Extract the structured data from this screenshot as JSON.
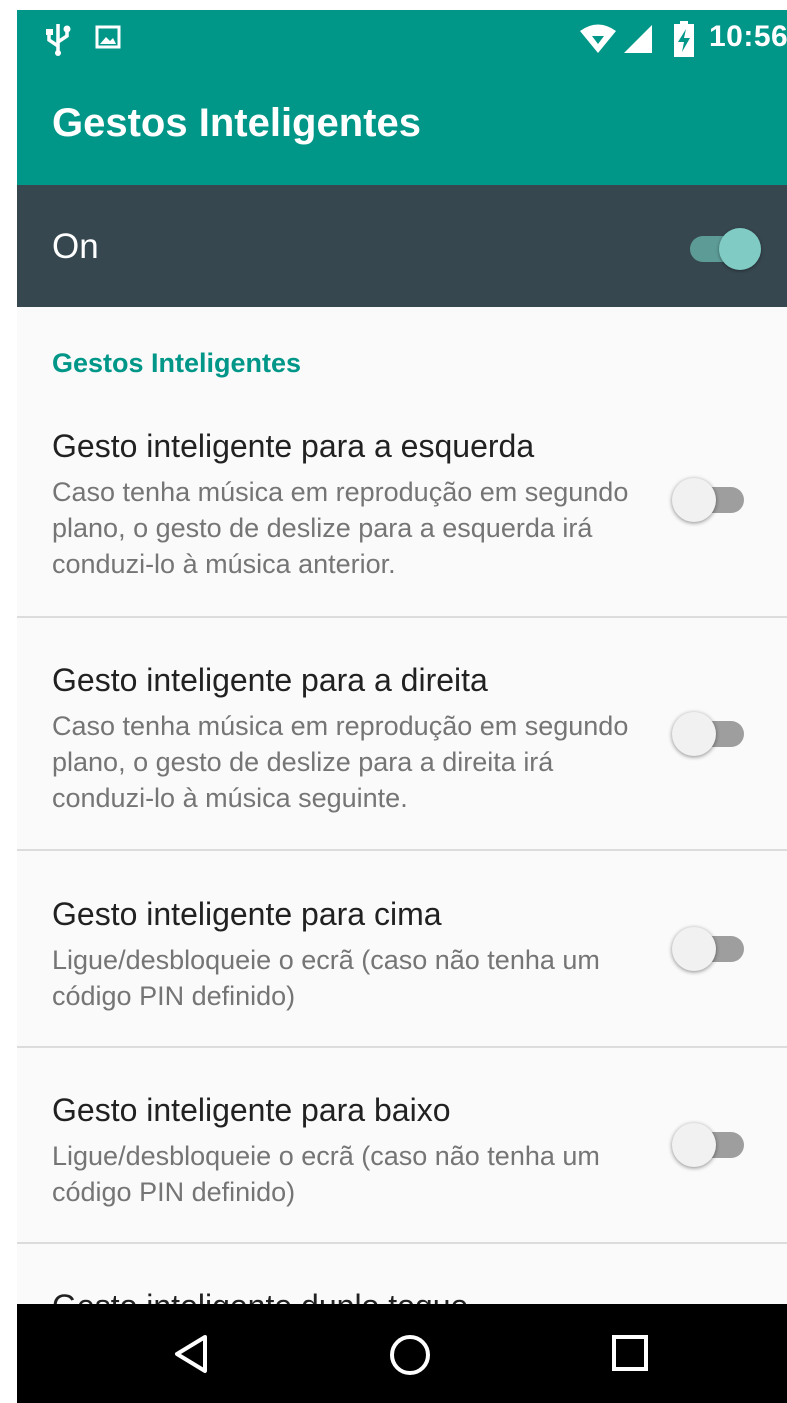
{
  "status_bar": {
    "time": "10:56",
    "icons": [
      "usb-icon",
      "gallery-icon",
      "wifi-icon",
      "cell-signal-icon",
      "battery-charging-icon"
    ]
  },
  "app_bar": {
    "title": "Gestos Inteligentes"
  },
  "master_switch": {
    "label": "On",
    "checked": true
  },
  "category": {
    "title": "Gestos Inteligentes"
  },
  "items": [
    {
      "title": "Gesto inteligente para a esquerda",
      "summary": "Caso tenha música em reprodução em segundo plano, o gesto de deslize para a esquerda irá conduzi-lo à música anterior.",
      "checked": false
    },
    {
      "title": "Gesto inteligente para a direita",
      "summary": "Caso tenha música em reprodução em segundo plano, o gesto de deslize para a direita irá conduzi-lo à música seguinte.",
      "checked": false
    },
    {
      "title": "Gesto inteligente para cima",
      "summary": "Ligue/desbloqueie o ecrã (caso não tenha um código PIN definido)",
      "checked": false
    },
    {
      "title": "Gesto inteligente para baixo",
      "summary": "Ligue/desbloqueie o ecrã (caso não tenha um código PIN definido)",
      "checked": false
    },
    {
      "title": "Gesto inteligente duplo toque",
      "summary": "",
      "checked": false
    }
  ],
  "nav_bar": {
    "buttons": [
      "back-icon",
      "home-icon",
      "recents-icon"
    ]
  },
  "colors": {
    "primary": "#009688",
    "master_bar": "#37474f",
    "accent_thumb": "#80cbc4",
    "background": "#fafafa"
  }
}
